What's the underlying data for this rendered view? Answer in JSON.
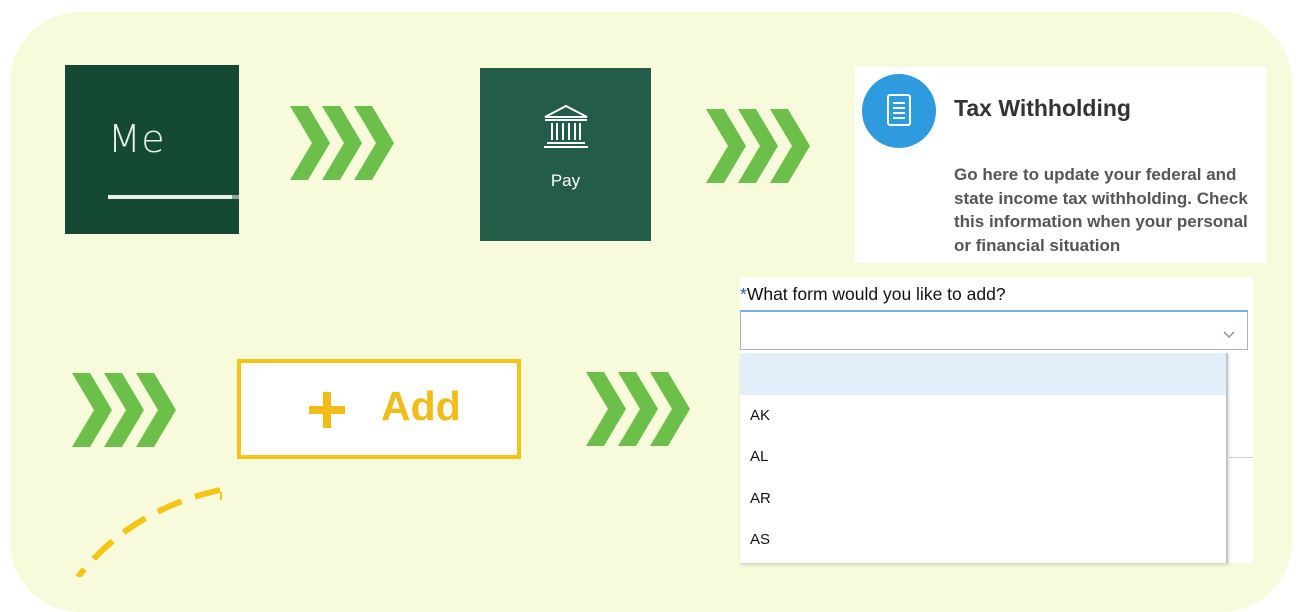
{
  "steps": {
    "me_tile": {
      "label": "Me"
    },
    "pay_tile": {
      "label": "Pay",
      "icon": "bank-building-icon"
    },
    "tax_card": {
      "title": "Tax Withholding",
      "description": "Go here to update your federal and state income tax withholding. Check this information when your personal or financial situation",
      "icon": "document-icon"
    },
    "add_button": {
      "label": "Add",
      "icon": "plus-icon"
    },
    "form_selector": {
      "required_mark": "*",
      "question": "What form would you like to add?",
      "selected_value": "",
      "options": [
        "",
        "AK",
        "AL",
        "AR",
        "AS"
      ]
    }
  },
  "colors": {
    "panel_background": "#f7fadb",
    "me_tile": "#144933",
    "pay_tile": "#245c4a",
    "chevron_green": "#6cc04a",
    "add_accent": "#f5c515",
    "tax_icon_blue": "#2d9bde"
  }
}
